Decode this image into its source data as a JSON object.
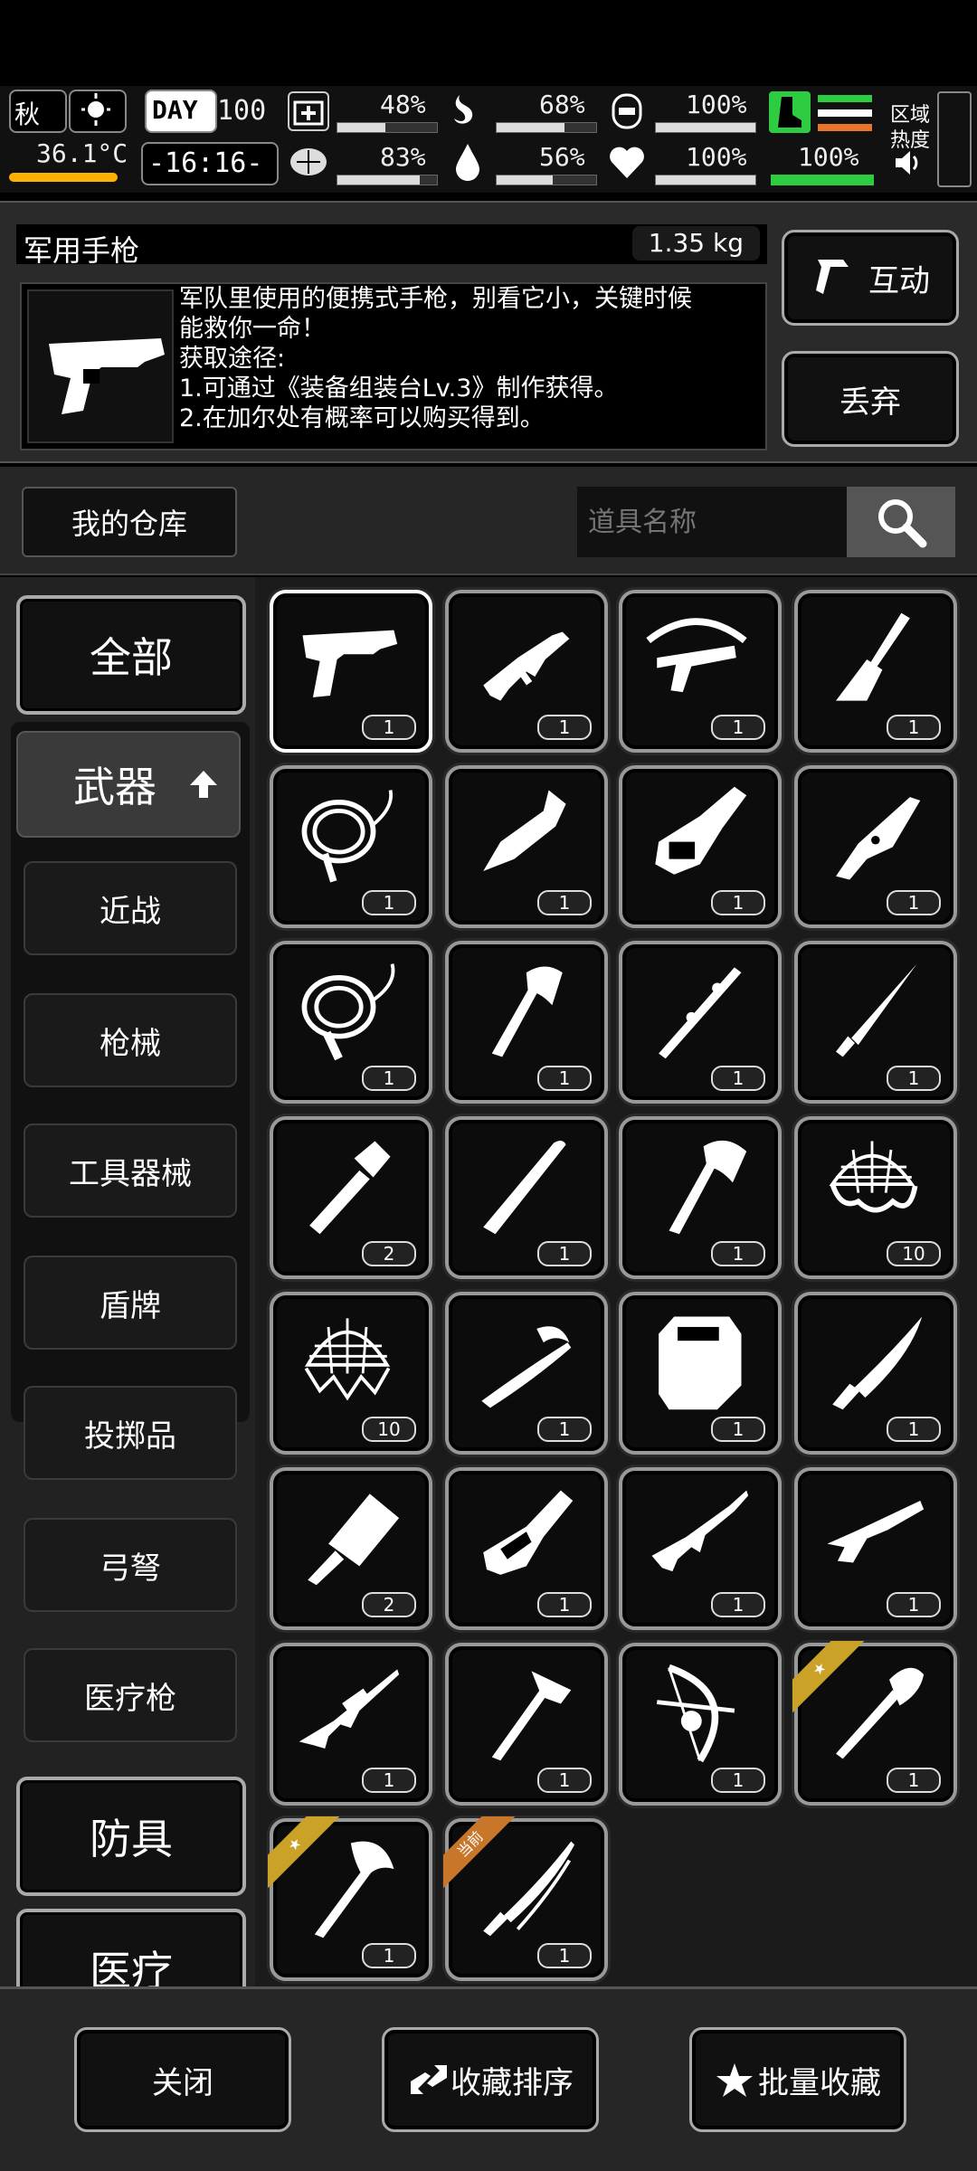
{
  "status": {
    "season": "秋",
    "temperature": "36.1°C",
    "day_label": "DAY",
    "day": "100",
    "clock": "-16:16-",
    "stats": [
      {
        "name": "medical",
        "value": "48%",
        "fill": 0.48
      },
      {
        "name": "stomach",
        "value": "68%",
        "fill": 0.68
      },
      {
        "name": "mask",
        "value": "100%",
        "fill": 1.0
      },
      {
        "name": "brain",
        "value": "83%",
        "fill": 0.83
      },
      {
        "name": "water",
        "value": "56%",
        "fill": 0.56
      },
      {
        "name": "heart",
        "value": "100%",
        "fill": 1.0
      }
    ],
    "stamina": "100%",
    "region_label_1": "区域",
    "region_label_2": "热度"
  },
  "item": {
    "name": "军用手枪",
    "weight": "1.35 kg",
    "desc_1": "军队里使用的便携式手枪，别看它小，关键时候",
    "desc_2": "能救你一命！",
    "desc_3": "获取途径:",
    "desc_4": "1.可通过《装备组装台Lv.3》制作获得。",
    "desc_5": "2.在加尔处有概率可以购买得到。",
    "interact_label": "互动",
    "drop_label": "丢弃"
  },
  "warehouse_label": "我的仓库",
  "search": {
    "placeholder": "道具名称"
  },
  "categories": {
    "all": "全部",
    "weapons": "武器",
    "melee": "近战",
    "guns": "枪械",
    "tools": "工具器械",
    "shield": "盾牌",
    "throwing": "投掷品",
    "bows": "弓弩",
    "medgun": "医疗枪",
    "armor": "防具",
    "medical": "医疗"
  },
  "slots": [
    {
      "icon": "pistol-icon",
      "qty": "1"
    },
    {
      "icon": "smg-icon",
      "qty": "1"
    },
    {
      "icon": "crossbow-icon",
      "qty": "1"
    },
    {
      "icon": "brush-icon",
      "qty": "1"
    },
    {
      "icon": "whip-icon",
      "qty": "1"
    },
    {
      "icon": "wrench-blade-icon",
      "qty": "1"
    },
    {
      "icon": "chainsaw-icon",
      "qty": "1"
    },
    {
      "icon": "knife-icon",
      "qty": "1"
    },
    {
      "icon": "rope-icon",
      "qty": "1"
    },
    {
      "icon": "axe-icon",
      "qty": "1"
    },
    {
      "icon": "staff-icon",
      "qty": "1"
    },
    {
      "icon": "dagger-icon",
      "qty": "1"
    },
    {
      "icon": "flashlight-icon",
      "qty": "2"
    },
    {
      "icon": "bat-icon",
      "qty": "1"
    },
    {
      "icon": "hatchet-icon",
      "qty": "1"
    },
    {
      "icon": "net-icon",
      "qty": "10"
    },
    {
      "icon": "trap-net-icon",
      "qty": "10"
    },
    {
      "icon": "sabre-icon",
      "qty": "1"
    },
    {
      "icon": "riot-shield-icon",
      "qty": "1"
    },
    {
      "icon": "machete-icon",
      "qty": "1"
    },
    {
      "icon": "cleaver-icon",
      "qty": "2"
    },
    {
      "icon": "minigun-icon",
      "qty": "1"
    },
    {
      "icon": "rifle-icon",
      "qty": "1"
    },
    {
      "icon": "shotgun-icon",
      "qty": "1"
    },
    {
      "icon": "sniper-icon",
      "qty": "1"
    },
    {
      "icon": "hammer-icon",
      "qty": "1"
    },
    {
      "icon": "bow-icon",
      "qty": "1"
    },
    {
      "icon": "shovel-icon",
      "qty": "1",
      "ribbon": "star"
    },
    {
      "icon": "battle-axe-icon",
      "qty": "1",
      "ribbon": "star"
    },
    {
      "icon": "katana-icon",
      "qty": "1",
      "ribbon": "当前"
    }
  ],
  "bottom": {
    "close_label": "关闭",
    "sort_label": "收藏排序",
    "batch_label": "批量收藏"
  }
}
